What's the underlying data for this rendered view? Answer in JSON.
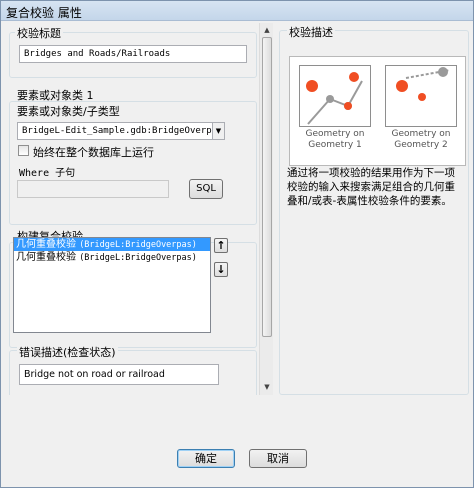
{
  "window": {
    "title": "复合校验 属性"
  },
  "check_title": {
    "label": "校验标题",
    "value": "Bridges and Roads/Railroads"
  },
  "feature_class": {
    "label": "要素或对象类 1",
    "subtype_label": "要素或对象类/子类型",
    "value": "BridgeL-Edit_Sample.gdb:BridgeOverpas",
    "run_on_entire_db_label": "始终在整个数据库上运行",
    "where_label": "Where 子句",
    "where_value": "",
    "sql_button": "SQL"
  },
  "build_check": {
    "label": "构建复合校验",
    "items": [
      {
        "name": "几何重叠校验",
        "detail": "(BridgeL:BridgeOverpas)",
        "selected": true
      },
      {
        "name": "几何重叠校验",
        "detail": "(BridgeL:BridgeOverpas)",
        "selected": false
      }
    ],
    "up_icon": "up-arrow-icon",
    "down_icon": "down-arrow-icon"
  },
  "error_desc": {
    "label": "错误描述(检查状态)",
    "value": "Bridge not on road or railroad"
  },
  "description": {
    "label": "校验描述",
    "card1_caption": "Geometry on Geometry 1",
    "card2_caption": "Geometry on Geometry 2",
    "text": "通过将一项校验的结果用作为下一项校验的输入来搜索满足组合的几何重叠和/或表-表属性校验条件的要素。"
  },
  "footer": {
    "ok": "确定",
    "cancel": "取消"
  },
  "colors": {
    "accent_dot": "#f04e23",
    "selection": "#3399ff",
    "line": "#9a9a9a"
  }
}
